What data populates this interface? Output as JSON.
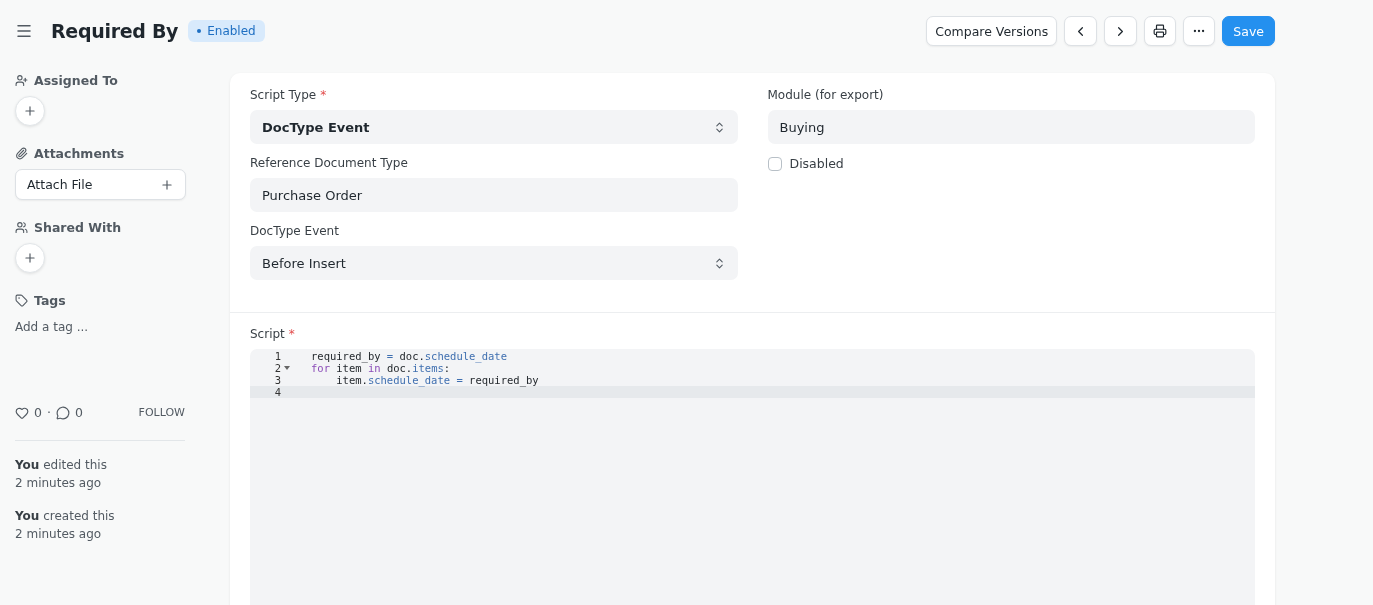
{
  "header": {
    "title": "Required By",
    "status": {
      "label": "Enabled",
      "color": "#1e6fc2"
    },
    "buttons": [
      {
        "kind": "text",
        "label": "Compare Versions"
      },
      {
        "kind": "prev"
      },
      {
        "kind": "next"
      },
      {
        "kind": "print"
      },
      {
        "kind": "more"
      },
      {
        "kind": "primary",
        "label": "Save"
      }
    ]
  },
  "sidebar": {
    "sections": [
      {
        "kind": "assign",
        "title": "Assigned To"
      },
      {
        "kind": "attach",
        "title": "Attachments",
        "button": "Attach File"
      },
      {
        "kind": "share",
        "title": "Shared With"
      },
      {
        "kind": "tags",
        "title": "Tags",
        "placeholder": "Add a tag ..."
      }
    ],
    "likes": "0",
    "separator": "·",
    "comments": "0",
    "follow": "FOLLOW",
    "activity": [
      {
        "text": "**You** edited this",
        "time": "2 minutes ago"
      },
      {
        "text": "**You** created this",
        "time": "2 minutes ago"
      }
    ]
  },
  "form": {
    "left": [
      {
        "kind": "select",
        "label": "Script Type",
        "required_mark": "*",
        "value": "DocType Event",
        "bold": true
      },
      {
        "kind": "input",
        "label": "Reference Document Type",
        "value": "Purchase Order",
        "bold": false
      },
      {
        "kind": "select",
        "label": "DocType Event",
        "value": "Before Insert",
        "bold": false
      }
    ],
    "right": [
      {
        "kind": "input",
        "label": "Module (for export)",
        "value": "Buying",
        "bold": false
      },
      {
        "kind": "checkbox",
        "label": "Disabled",
        "checked": false
      }
    ],
    "script": {
      "label": "Script",
      "required_mark": "*",
      "lines": [
        {
          "number": "1",
          "foldable": false,
          "active": false,
          "tokens": [
            {
              "text": "required_by ",
              "kind": "plain"
            },
            {
              "text": "=",
              "kind": "op"
            },
            {
              "text": " doc.",
              "kind": "plain"
            },
            {
              "text": "schedule_date",
              "kind": "prop"
            }
          ]
        },
        {
          "number": "2",
          "foldable": true,
          "active": false,
          "tokens": [
            {
              "text": "for",
              "kind": "keyword"
            },
            {
              "text": " item ",
              "kind": "plain"
            },
            {
              "text": "in",
              "kind": "keyword"
            },
            {
              "text": " doc.",
              "kind": "plain"
            },
            {
              "text": "items",
              "kind": "prop"
            },
            {
              "text": ":",
              "kind": "plain"
            }
          ]
        },
        {
          "number": "3",
          "foldable": false,
          "active": false,
          "tokens": [
            {
              "text": "    item.",
              "kind": "plain"
            },
            {
              "text": "schedule_date",
              "kind": "prop"
            },
            {
              "text": " =",
              "kind": "op"
            },
            {
              "text": " required_by",
              "kind": "plain"
            }
          ]
        },
        {
          "number": "4",
          "foldable": false,
          "active": true
        }
      ]
    }
  }
}
